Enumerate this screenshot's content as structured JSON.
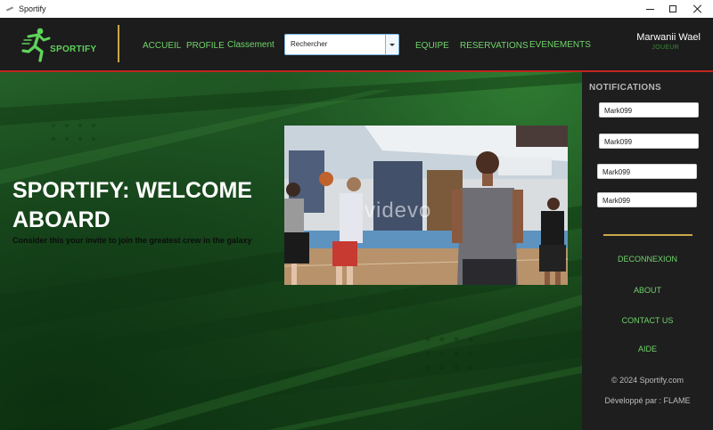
{
  "window": {
    "title": "Sportify"
  },
  "header": {
    "brand": "SPORTIFY",
    "nav": {
      "accueil": "ACCUEIL",
      "profile": "PROFILE",
      "classement": "Classement",
      "equipe": "EQUIPE",
      "reservations": "RESERVATIONS",
      "evenements": "EVENEMENTS"
    },
    "search": {
      "value": "Rechercher"
    },
    "user": {
      "name": "Marwanii Wael",
      "role": "JOUEUR"
    }
  },
  "hero": {
    "title": "SPORTIFY: WELCOME ABOARD",
    "subtitle": "Consider this your invite to join the greatest crew in the galaxy",
    "video_watermark": "videvo"
  },
  "sidebar": {
    "notifications_title": "NOTIFICATIONS",
    "notifications": [
      "Mark099",
      "Mark099",
      "Mark099",
      "Mark099"
    ],
    "links": {
      "deconnexion": "DECONNEXION",
      "about": "ABOUT",
      "contact": "CONTACT US",
      "aide": "AIDE"
    },
    "copyright": "© 2024 Sportify.com",
    "developer": "Développé par :  FLAME"
  },
  "colors": {
    "accent_green": "#6fd46a",
    "header_bg": "#1c1c1c",
    "sidebar_bg": "#1e1e1e",
    "divider_gold": "#c9a84a",
    "header_border_red": "#c0261f"
  }
}
